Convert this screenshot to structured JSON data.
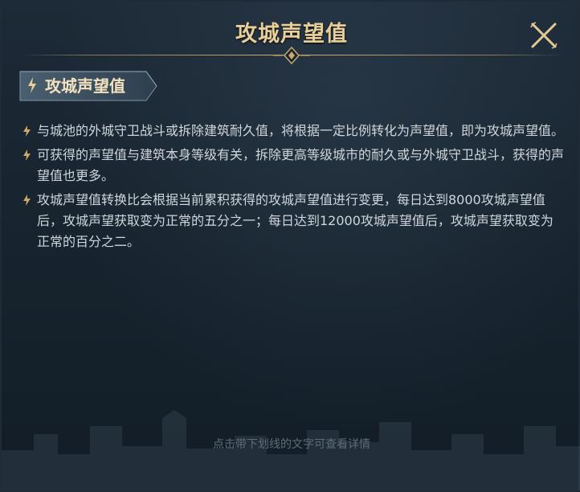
{
  "dialog": {
    "title": "攻城声望值",
    "close_icon": "close-x-icon",
    "accent_color": "#c9a96a"
  },
  "section": {
    "tag_label": "攻城声望值",
    "icon": "lightning-bolt-icon"
  },
  "bullets": [
    {
      "icon": "lightning-bolt-icon",
      "text": "与城池的外城守卫战斗或拆除建筑耐久值，将根据一定比例转化为声望值，即为攻城声望值。"
    },
    {
      "icon": "lightning-bolt-icon",
      "text": "可获得的声望值与建筑本身等级有关，拆除更高等级城市的耐久或与外城守卫战斗，获得的声望值也更多。"
    },
    {
      "icon": "lightning-bolt-icon",
      "text": "攻城声望值转换比会根据当前累积获得的攻城声望值进行变更，每日达到8000攻城声望值后，攻城声望获取变为正常的五分之一；每日达到12000攻城声望值后，攻城声望获取变为正常的百分之二。"
    }
  ],
  "footer": {
    "hint": "点击带下划线的文字可查看详情"
  }
}
